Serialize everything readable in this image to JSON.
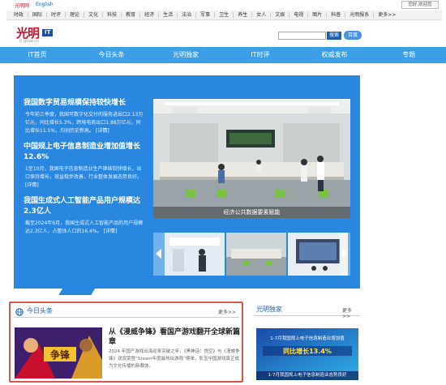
{
  "top": {
    "logo_text": "光明网",
    "english": "English",
    "register": "您好,欢迎您"
  },
  "channels": [
    "时政",
    "国际",
    "时评",
    "理论",
    "文化",
    "科技",
    "教育",
    "经济",
    "生活",
    "法治",
    "军事",
    "卫生",
    "养生",
    "女人",
    "文娱",
    "电视",
    "图片",
    "科普",
    "光明报系",
    "更多>>"
  ],
  "brand": {
    "cn": "光明",
    "tag": "IT",
    "url": "it.gmw.cn"
  },
  "search": {
    "placeholder": "",
    "button": "搜索",
    "baidu": "百度"
  },
  "nav": [
    "IT首页",
    "今日头条",
    "光明独家",
    "IT时评",
    "权威发布",
    "专题"
  ],
  "hero": {
    "news": [
      {
        "title": "我国数字贸易规模保持较快增长",
        "body": "今年前三季度，我国可数字化交付的服务进出口2.13万亿元，同比增长5.3%，跨境电商出口1.88万亿元，同比增长11.5%，均创历史新高。",
        "more": "[详情]"
      },
      {
        "title": "中国规上电子信息制造业增加值增长12.6%",
        "body": "1至10月，我国电子信息制造业生产继续较快增长，出口保持增长，效益稳步改善，行业整体发展态势良好。",
        "more": "[详情]"
      },
      {
        "title": "我国生成式人工智能产品用户规模达2.3亿人",
        "body": "截至2024年6月，我国生成式人工智能产品的用户规模达2.3亿人，占整体人口的16.4%。",
        "more": "[详情]"
      }
    ],
    "caption": "经济公共数据要素赋能"
  },
  "today": {
    "title": "今日头条",
    "more": "更多>>",
    "article_title": "从《漫威争锋》看国产游戏翻开全球新篇章",
    "article_body": "2024 年国产游戏出海迎来突破之年，《黑神话：悟空》与《漫威争锋》双双荣登“Steam年度最热玩游戏”榜单，彰显中国游戏真正成为文化传播的新载体。",
    "thumb_text": "争锋"
  },
  "guangming": {
    "title": "光明独家",
    "more": "更多>>",
    "promo_line1": "1-7月我国规上电子信息制造业增加值",
    "promo_line2": "同比增长13.4%",
    "caption": "1-7月我国规上电子信息制造业态势良好"
  }
}
